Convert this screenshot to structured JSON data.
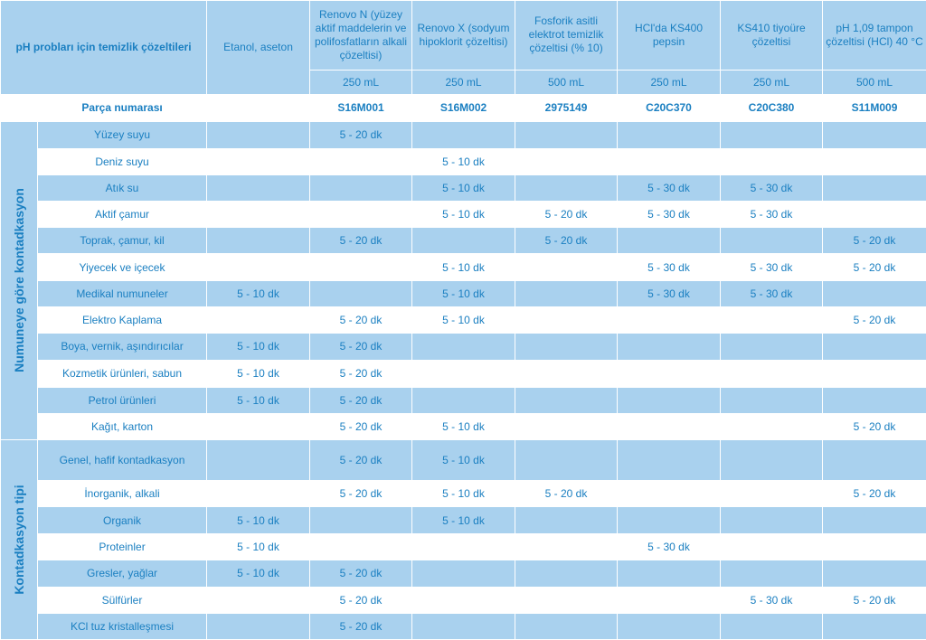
{
  "header": {
    "corner_title": "pH probları için temizlik çözeltileri",
    "part_label": "Parça numarası",
    "columns": [
      {
        "name": "Etanol, aseton",
        "volume": "",
        "part": ""
      },
      {
        "name": "Renovo N (yüzey aktif maddelerin ve polifosfatların alkali çözeltisi)",
        "volume": "250 mL",
        "part": "S16M001"
      },
      {
        "name": "Renovo X (sodyum hipoklorit çözeltisi)",
        "volume": "250 mL",
        "part": "S16M002"
      },
      {
        "name": "Fosforik asitli elektrot temizlik çözeltisi (% 10)",
        "volume": "500 mL",
        "part": "2975149"
      },
      {
        "name": "HCl'da KS400 pepsin",
        "volume": "250 mL",
        "part": "C20C370"
      },
      {
        "name": "KS410 tiyoüre çözeltisi",
        "volume": "250 mL",
        "part": "C20C380"
      },
      {
        "name": "pH 1,09 tampon çözeltisi (HCl) 40 °C",
        "volume": "500 mL",
        "part": "S11M009"
      }
    ]
  },
  "groups": [
    {
      "label": "Numuneye göre kontadkasyon",
      "rows": [
        {
          "label": "Yüzey suyu",
          "cells": [
            "",
            "5 - 20 dk",
            "",
            "",
            "",
            "",
            ""
          ]
        },
        {
          "label": "Deniz suyu",
          "cells": [
            "",
            "",
            "5 - 10 dk",
            "",
            "",
            "",
            ""
          ]
        },
        {
          "label": "Atık su",
          "cells": [
            "",
            "",
            "5 - 10 dk",
            "",
            "5 - 30 dk",
            "5 - 30 dk",
            ""
          ]
        },
        {
          "label": "Aktif çamur",
          "cells": [
            "",
            "",
            "5 - 10 dk",
            "5 - 20 dk",
            "5 - 30 dk",
            "5 - 30 dk",
            ""
          ]
        },
        {
          "label": "Toprak, çamur, kil",
          "cells": [
            "",
            "5 - 20 dk",
            "",
            "5 - 20 dk",
            "",
            "",
            "5 - 20 dk"
          ]
        },
        {
          "label": "Yiyecek ve içecek",
          "cells": [
            "",
            "",
            "5 - 10 dk",
            "",
            "5 - 30 dk",
            "5 - 30 dk",
            "5 - 20 dk"
          ]
        },
        {
          "label": "Medikal numuneler",
          "cells": [
            "5 - 10 dk",
            "",
            "5 - 10 dk",
            "",
            "5 - 30 dk",
            "5 - 30 dk",
            ""
          ]
        },
        {
          "label": "Elektro Kaplama",
          "cells": [
            "",
            "5 - 20 dk",
            "5 - 10 dk",
            "",
            "",
            "",
            "5 - 20 dk"
          ]
        },
        {
          "label": "Boya, vernik, aşındırıcılar",
          "cells": [
            "5 - 10 dk",
            "5 - 20 dk",
            "",
            "",
            "",
            "",
            ""
          ]
        },
        {
          "label": "Kozmetik ürünleri, sabun",
          "cells": [
            "5 - 10 dk",
            "5 - 20 dk",
            "",
            "",
            "",
            "",
            ""
          ]
        },
        {
          "label": "Petrol ürünleri",
          "cells": [
            "5 - 10 dk",
            "5 - 20 dk",
            "",
            "",
            "",
            "",
            ""
          ]
        },
        {
          "label": "Kağıt, karton",
          "cells": [
            "",
            "5 - 20 dk",
            "5 - 10 dk",
            "",
            "",
            "",
            "5 - 20 dk"
          ]
        }
      ]
    },
    {
      "label": "Kontadkasyon tipi",
      "rows": [
        {
          "label": "Genel, hafif kontadkasyon",
          "cells": [
            "",
            "5 - 20 dk",
            "5 - 10 dk",
            "",
            "",
            "",
            ""
          ]
        },
        {
          "label": "İnorganik, alkali",
          "cells": [
            "",
            "5 - 20 dk",
            "5 - 10 dk",
            "5 - 20 dk",
            "",
            "",
            "5 - 20 dk"
          ]
        },
        {
          "label": "Organik",
          "cells": [
            "5 - 10 dk",
            "",
            "5 - 10 dk",
            "",
            "",
            "",
            ""
          ]
        },
        {
          "label": "Proteinler",
          "cells": [
            "5 - 10 dk",
            "",
            "",
            "",
            "5 - 30 dk",
            "",
            ""
          ]
        },
        {
          "label": "Gresler, yağlar",
          "cells": [
            "5 - 10 dk",
            "5 - 20 dk",
            "",
            "",
            "",
            "",
            ""
          ]
        },
        {
          "label": "Sülfürler",
          "cells": [
            "",
            "5 - 20 dk",
            "",
            "",
            "",
            "5 - 30 dk",
            "5 - 20 dk"
          ]
        },
        {
          "label": "KCl tuz kristalleşmesi",
          "cells": [
            "",
            "5 - 20 dk",
            "",
            "",
            "",
            "",
            ""
          ]
        }
      ]
    }
  ],
  "colors": {
    "blue_fill": "#a9d1ee",
    "text_blue": "#1a7fc1",
    "white": "#ffffff"
  }
}
